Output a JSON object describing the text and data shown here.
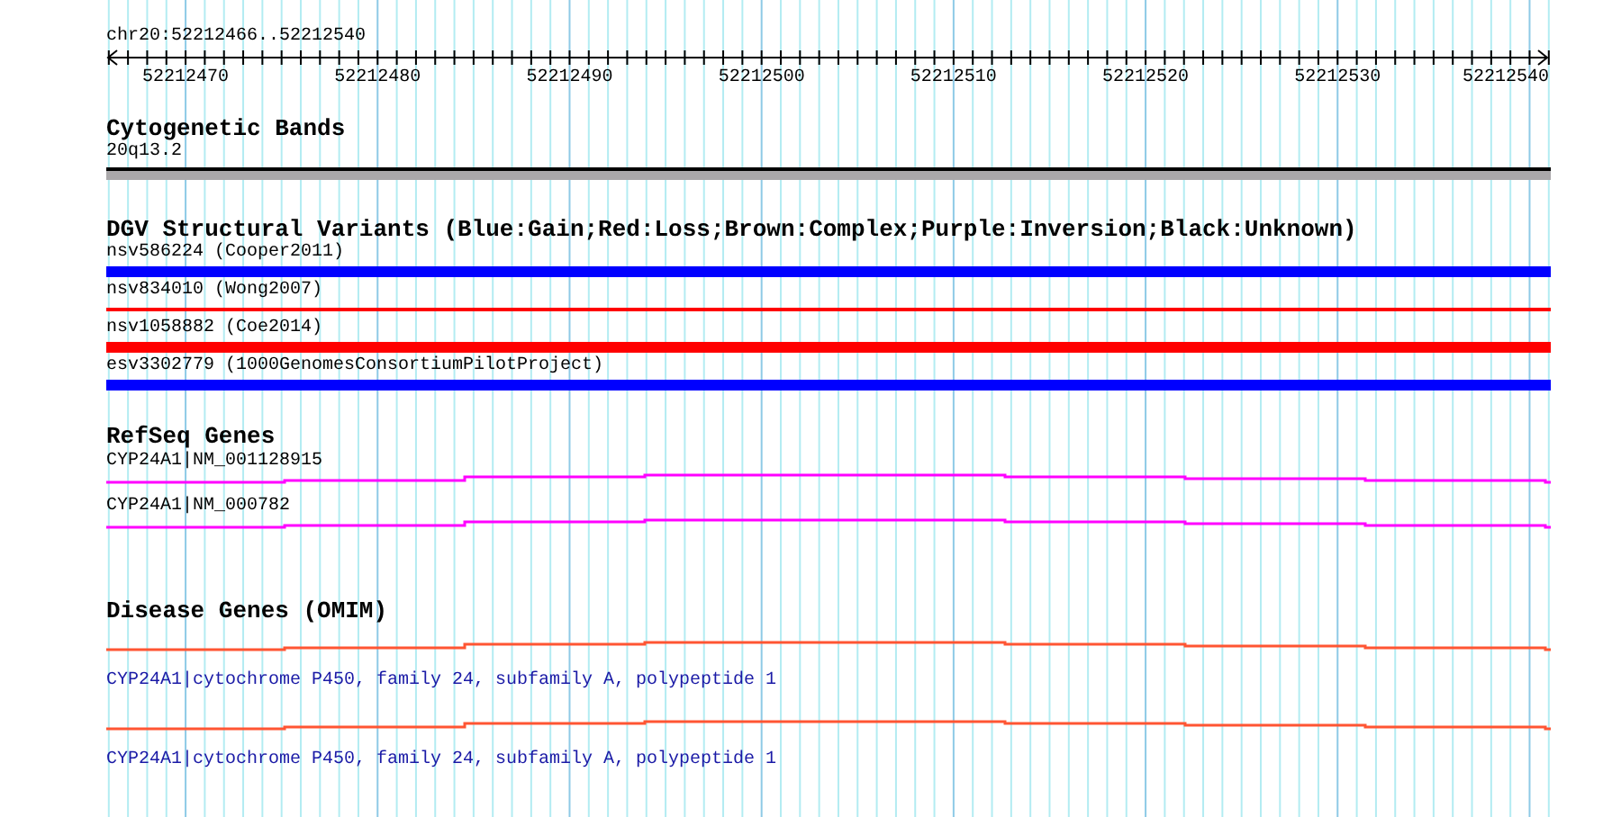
{
  "ruler": {
    "title": "chr20:52212466..52212540",
    "ticks": [
      "52212470",
      "52212480",
      "52212490",
      "52212500",
      "52212510",
      "52212520",
      "52212530",
      "52212540"
    ]
  },
  "tracks": [
    {
      "kind": "band",
      "title": "Cytogenetic Bands",
      "features": [
        {
          "label": "20q13.2"
        }
      ]
    },
    {
      "kind": "variant",
      "title": "DGV Structural Variants (Blue:Gain;Red:Loss;Brown:Complex;Purple:Inversion;Black:Unknown)",
      "features": [
        {
          "label": "nsv586224 (Cooper2011)",
          "color": "#0000ff",
          "kind": "thick"
        },
        {
          "label": "nsv834010 (Wong2007)",
          "color": "#ff0000",
          "kind": "thin"
        },
        {
          "label": "nsv1058882 (Coe2014)",
          "color": "#ff0000",
          "kind": "thick"
        },
        {
          "label": "esv3302779 (1000GenomesConsortiumPilotProject)",
          "color": "#0000ff",
          "kind": "thick"
        }
      ]
    },
    {
      "kind": "gene",
      "title": "RefSeq Genes",
      "features": [
        {
          "label": "CYP24A1|NM_001128915"
        },
        {
          "label": "CYP24A1|NM_000782"
        }
      ]
    },
    {
      "kind": "disease",
      "title": "Disease Genes (OMIM)",
      "features": [
        {
          "label": "CYP24A1|cytochrome P450, family 24, subfamily A, polypeptide 1"
        },
        {
          "label": "CYP24A1|cytochrome P450, family 24, subfamily A, polypeptide 1"
        }
      ]
    }
  ]
}
